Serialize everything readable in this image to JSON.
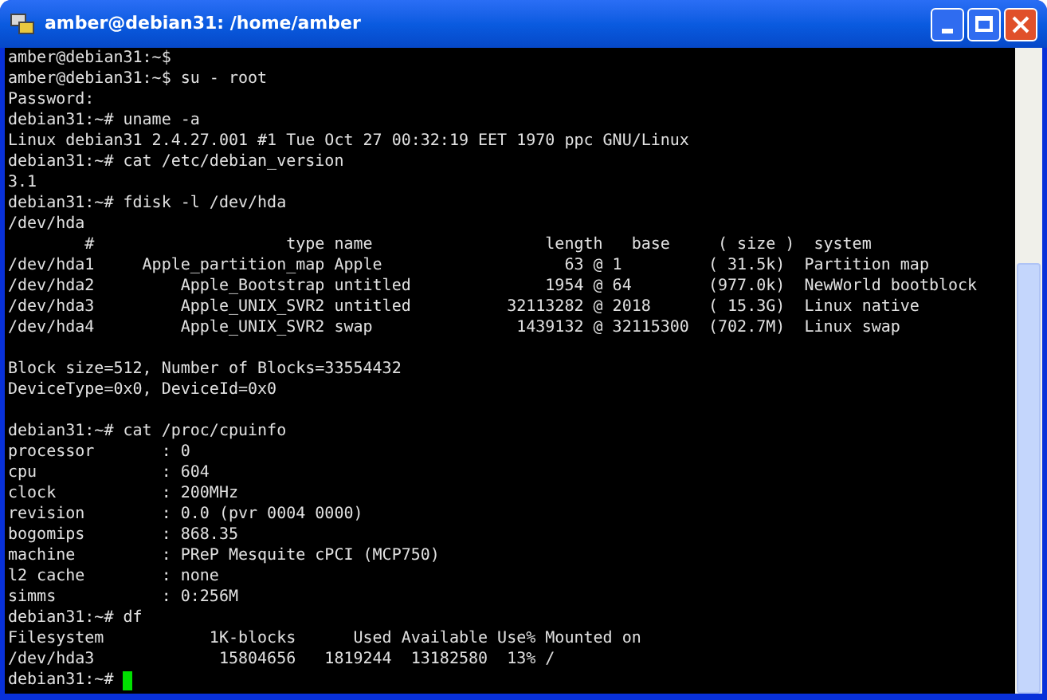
{
  "window": {
    "title": "amber@debian31: /home/amber"
  },
  "terminal": {
    "blocks": [
      [
        "amber@debian31:~$",
        "amber@debian31:~$ su - root",
        "Password:",
        "debian31:~# uname -a",
        "Linux debian31 2.4.27.001 #1 Tue Oct 27 00:32:19 EET 1970 ppc GNU/Linux",
        "debian31:~# cat /etc/debian_version",
        "3.1",
        "debian31:~# fdisk -l /dev/hda",
        "/dev/hda",
        "        #                    type name                  length   base     ( size )  system",
        "/dev/hda1     Apple_partition_map Apple                   63 @ 1         ( 31.5k)  Partition map",
        "/dev/hda2         Apple_Bootstrap untitled              1954 @ 64        (977.0k)  NewWorld bootblock",
        "/dev/hda3         Apple_UNIX_SVR2 untitled          32113282 @ 2018      ( 15.3G)  Linux native",
        "/dev/hda4         Apple_UNIX_SVR2 swap               1439132 @ 32115300  (702.7M)  Linux swap"
      ],
      [
        "Block size=512, Number of Blocks=33554432",
        "DeviceType=0x0, DeviceId=0x0"
      ],
      [
        "debian31:~# cat /proc/cpuinfo",
        "processor       : 0",
        "cpu             : 604",
        "clock           : 200MHz",
        "revision        : 0.0 (pvr 0004 0000)",
        "bogomips        : 868.35",
        "machine         : PReP Mesquite cPCI (MCP750)",
        "l2 cache        : none",
        "simms           : 0:256M",
        "debian31:~# df",
        "Filesystem           1K-blocks      Used Available Use% Mounted on",
        "/dev/hda3             15804656   1819244  13182580  13% /",
        "debian31:~#"
      ]
    ]
  }
}
